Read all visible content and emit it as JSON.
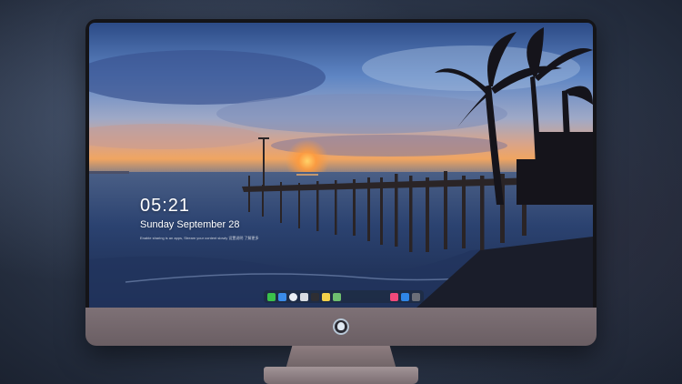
{
  "lockscreen": {
    "time": "05:21",
    "date": "Sunday September  28",
    "subtitle": "Enable sharing is an apps, Stream your content slowly  设置说明  了解更多"
  },
  "dock": {
    "left_icons": [
      {
        "name": "messages-icon",
        "color": "#3ac24a"
      },
      {
        "name": "finder-icon",
        "color": "#3a8be8"
      },
      {
        "name": "safari-icon",
        "color": "#e9eef3"
      },
      {
        "name": "preview-icon",
        "color": "#d9dde2"
      },
      {
        "name": "clapper-icon",
        "color": "#2e2e33"
      },
      {
        "name": "notes-icon",
        "color": "#f4d24a"
      },
      {
        "name": "photos-icon",
        "color": "#6fbf6f"
      }
    ],
    "right_icons": [
      {
        "name": "music-icon",
        "color": "#f04a7a"
      },
      {
        "name": "app-store-icon",
        "color": "#2f86e6"
      },
      {
        "name": "camera-icon",
        "color": "#6b6f78"
      }
    ]
  }
}
